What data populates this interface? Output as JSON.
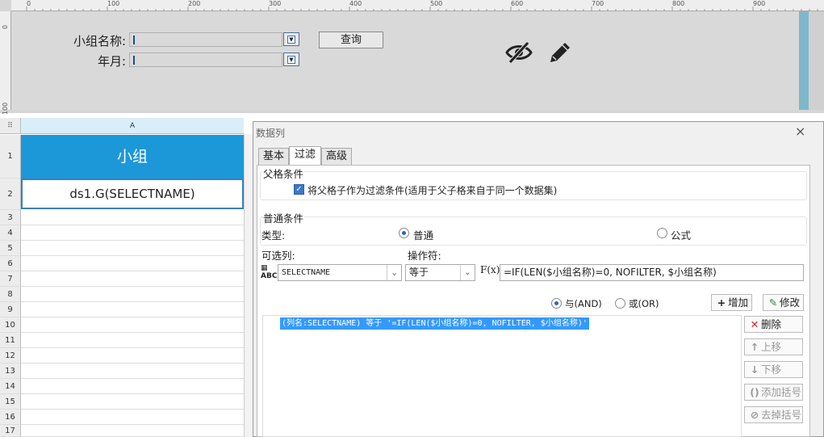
{
  "ruler": {
    "top_labels": [
      "0",
      "100",
      "200",
      "300",
      "400",
      "500",
      "600",
      "700",
      "800",
      "900"
    ],
    "left_labels": [
      "0",
      "100"
    ]
  },
  "form": {
    "group_name_label": "小组名称:",
    "year_month_label": "年月:",
    "query_button": "查询"
  },
  "sheet": {
    "corner_icon": "grid-icon",
    "column_a": "A",
    "rows": [
      "1",
      "2",
      "3",
      "4",
      "5",
      "6",
      "7",
      "8",
      "9",
      "10",
      "11",
      "12",
      "13",
      "14",
      "15",
      "16",
      "17"
    ],
    "cell_a1": "小组",
    "cell_a2": "ds1.G(SELECTNAME)",
    "header_color": "#1c98d9"
  },
  "dialog": {
    "title": "数据列",
    "close": "×",
    "tabs": [
      "基本",
      "过滤",
      "高级"
    ],
    "active_tab": "过滤",
    "parent_group_title": "父格条件",
    "parent_checkbox_label": "将父格子作为过滤条件(适用于父子格来自于同一个数据集)",
    "parent_checkbox_checked": true,
    "normal_group_title": "普通条件",
    "type_label": "类型:",
    "type_options": [
      "普通",
      "公式"
    ],
    "type_selected": "普通",
    "available_columns_label": "可选列:",
    "operator_label": "操作符:",
    "column_value": "SELECTNAME",
    "operator_value": "等于",
    "formula_prefix": "F(x)",
    "formula_value": "=IF(LEN($小组名称)=0, NOFILTER, $小组名称)",
    "logic_options": [
      "与(AND)",
      "或(OR)"
    ],
    "logic_selected": "与(AND)",
    "add_button": "增加",
    "modify_button": "修改",
    "conditions": [
      "(列名:SELECTNAME) 等于 '=IF(LEN($小组名称)=0, NOFILTER, $小组名称)'"
    ],
    "side_buttons": [
      "删除",
      "上移",
      "下移",
      "添加括号",
      "去掉括号"
    ]
  }
}
